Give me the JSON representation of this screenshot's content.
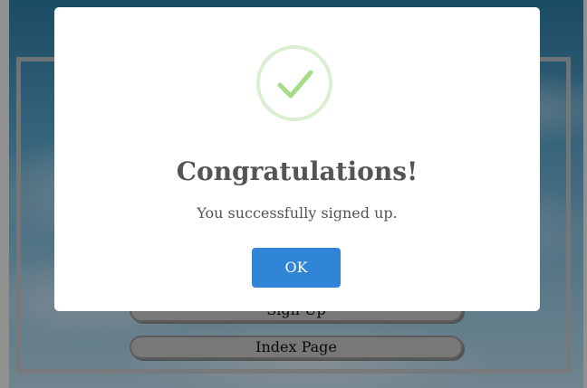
{
  "background_page": {
    "buttons": [
      {
        "label": "Sign Up"
      },
      {
        "label": "Index Page"
      }
    ]
  },
  "dialog": {
    "icon": "success-check-icon",
    "title": "Congratulations!",
    "message": "You successfully signed up.",
    "ok_label": "OK",
    "colors": {
      "confirm_button": "#3085d6",
      "check_stroke": "#a5dc86",
      "check_ring": "#d9efd0",
      "text": "#545454"
    }
  }
}
